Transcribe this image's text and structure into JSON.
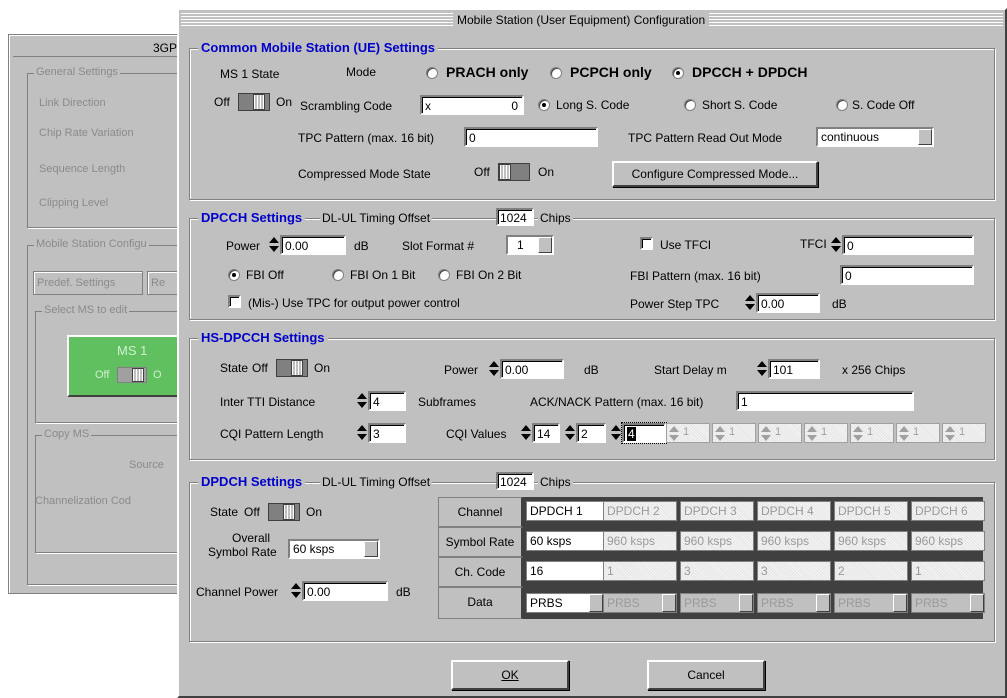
{
  "background_window": {
    "title_fragment": "3GPF",
    "general_settings": "General Settings",
    "rows": [
      "Link Direction",
      "Chip Rate Variation",
      "Sequence Length",
      "Clipping Level"
    ],
    "mobile_station_config": "Mobile Station Configu",
    "predef_button": "Predef. Settings",
    "re_button": "Re",
    "select_ms": "Select MS to edit",
    "ms1_label": "MS 1",
    "ms1_off": "Off",
    "ms1_on": "O",
    "copy_ms": "Copy MS",
    "source": "Source",
    "channelization": "Channelization Cod",
    "ms_tile_color": "#60c060"
  },
  "dialog": {
    "title": "Mobile Station (User Equipment) Configuration",
    "common": {
      "heading": "Common Mobile Station (UE) Settings",
      "ms1_state": "MS 1 State",
      "mode": "Mode",
      "off": "Off",
      "on": "On",
      "mode_options": [
        "PRACH only",
        "PCPCH only",
        "DPCCH + DPDCH"
      ],
      "mode_selected": "DPCCH + DPDCH",
      "scrambling_code_label": "Scrambling Code",
      "scrambling_prefix": "x",
      "scrambling_value": "0",
      "code_options": [
        "Long S. Code",
        "Short S. Code",
        "S. Code Off"
      ],
      "code_selected": "Long S. Code",
      "tpc_pattern_label": "TPC Pattern (max. 16 bit)",
      "tpc_pattern_value": "0",
      "tpc_readout_label": "TPC Pattern Read Out Mode",
      "tpc_readout_value": "continuous",
      "compressed_label": "Compressed Mode State",
      "configure_compressed": "Configure Compressed Mode..."
    },
    "dpcch": {
      "heading": "DPCCH Settings",
      "timing_label": "DL-UL Timing Offset",
      "timing_value": "1024",
      "chips": "Chips",
      "power_label": "Power",
      "power_value": "0.00",
      "db": "dB",
      "slot_format_label": "Slot Format #",
      "slot_format_value": "1",
      "use_tfci": "Use TFCI",
      "tfci_label": "TFCI",
      "tfci_value": "0",
      "fbi_options": [
        "FBI Off",
        "FBI On  1 Bit",
        "FBI On  2 Bit"
      ],
      "fbi_selected": "FBI Off",
      "fbi_pattern_label": "FBI Pattern (max. 16 bit)",
      "fbi_pattern_value": "0",
      "mis_use": "(Mis-) Use TPC for output power control",
      "power_step_label": "Power Step TPC",
      "power_step_value": "0.00",
      "db2": "dB"
    },
    "hs": {
      "heading": "HS-DPCCH Settings",
      "state": "State",
      "off": "Off",
      "on": "On",
      "power_label": "Power",
      "power_value": "0.00",
      "db": "dB",
      "start_delay_label": "Start Delay m",
      "start_delay_value": "101",
      "chips_unit": "x 256 Chips",
      "inter_tti_label": "Inter TTI Distance",
      "inter_tti_value": "4",
      "subframes": "Subframes",
      "ack_label": "ACK/NACK Pattern (max. 16 bit)",
      "ack_value": "1",
      "cqi_len_label": "CQI Pattern Length",
      "cqi_len_value": "3",
      "cqi_values_label": "CQI Values",
      "cqi_values": [
        "14",
        "2",
        "4"
      ],
      "cqi_disabled": [
        "1",
        "1",
        "1",
        "1",
        "1",
        "1",
        "1"
      ]
    },
    "dpdch": {
      "heading": "DPDCH Settings",
      "timing_label": "DL-UL Timing Offset",
      "timing_value": "1024",
      "chips": "Chips",
      "state": "State",
      "off": "Off",
      "on": "On",
      "overall_label_1": "Overall",
      "overall_label_2": "Symbol Rate",
      "overall_value": "60 ksps",
      "channel_power_label": "Channel Power",
      "channel_power_value": "0.00",
      "db": "dB",
      "table": {
        "row_headers": [
          "Channel",
          "Symbol Rate",
          "Ch. Code",
          "Data"
        ],
        "channels": [
          "DPDCH 1",
          "DPDCH 2",
          "DPDCH 3",
          "DPDCH 4",
          "DPDCH 5",
          "DPDCH 6"
        ],
        "symbol_rates": [
          "60 ksps",
          "960 ksps",
          "960 ksps",
          "960 ksps",
          "960 ksps",
          "960 ksps"
        ],
        "ch_codes": [
          "16",
          "1",
          "3",
          "3",
          "2",
          "1"
        ],
        "data": [
          "PRBS",
          "PRBS",
          "PRBS",
          "PRBS",
          "PRBS",
          "PRBS"
        ]
      }
    },
    "ok": "OK",
    "cancel": "Cancel"
  }
}
